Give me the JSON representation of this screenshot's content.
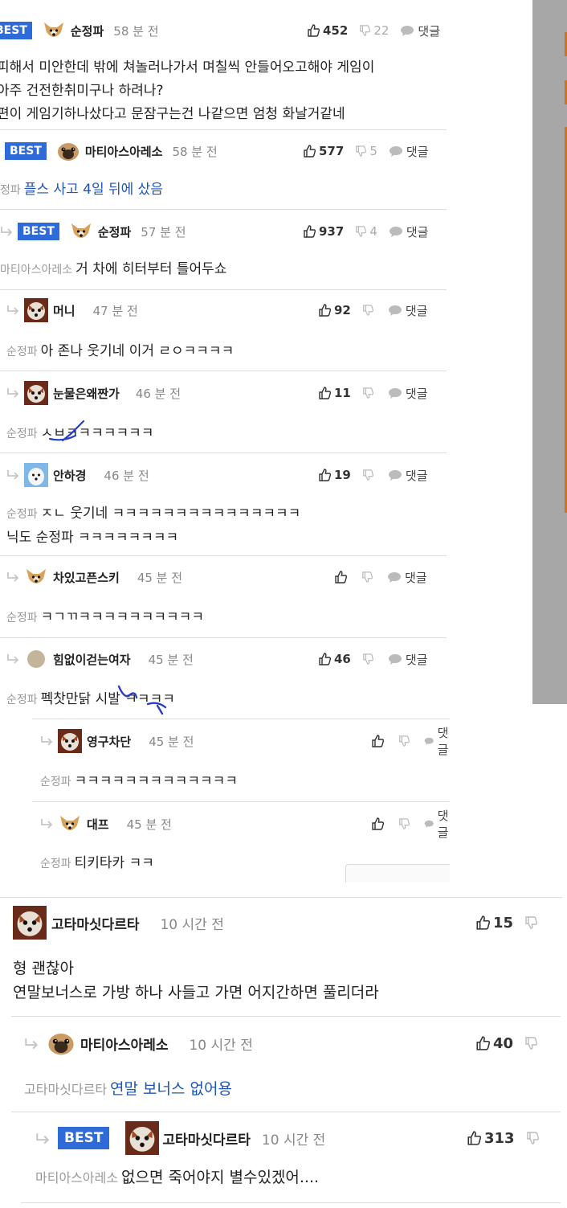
{
  "top_comments": [
    {
      "best": true,
      "name": "순정파",
      "time": "58 분 전",
      "likes": "452",
      "dislikes": "22",
      "reply_label": "댓글",
      "to": "",
      "text": "피해서 미안한데 밖에 쳐놀러나가서 며칠씩 안들어오고해야 게임이\n아주 건전한취미구나 하려나?\n편이 게임기하나샀다고 문잠구는건 나같으면 엄청 화날거같네"
    },
    {
      "best": true,
      "name": "마티아스아레소",
      "time": "58 분 전",
      "likes": "577",
      "dislikes": "5",
      "reply_label": "댓글",
      "to": "정파",
      "text": "플스 사고 4일 뒤에 샀음"
    },
    {
      "best": true,
      "name": "순정파",
      "time": "57 분 전",
      "likes": "937",
      "dislikes": "4",
      "reply_label": "댓글",
      "to": "마티아스아레소",
      "text": "거 차에 히터부터 틀어두쇼"
    },
    {
      "best": false,
      "name": "머니",
      "time": "47 분 전",
      "likes": "92",
      "dislikes": "",
      "reply_label": "댓글",
      "to": "순정파",
      "text": "아 존나 웃기네 이거 ㄹㅇㅋㅋㅋㅋ"
    },
    {
      "best": false,
      "name": "눈물은왜짠가",
      "time": "46 분 전",
      "likes": "11",
      "dislikes": "",
      "reply_label": "댓글",
      "to": "순정파",
      "text": "ㅅㅂㅋㅋㅋㅋㅋㅋㅋ"
    },
    {
      "best": false,
      "name": "안하경",
      "time": "46 분 전",
      "likes": "19",
      "dislikes": "",
      "reply_label": "댓글",
      "to": "순정파",
      "text": "ㅈㄴ 웃기네 ㅋㅋㅋㅋㅋㅋㅋㅋㅋㅋㅋㅋㅋㅋㅋ\n닉도 순정파 ㅋㅋㅋㅋㅋㅋㅋㅋ"
    },
    {
      "best": false,
      "name": "차있고픈스키",
      "time": "45 분 전",
      "likes": "",
      "dislikes": "",
      "reply_label": "댓글",
      "to": "순정파",
      "text": "ㅋㄱㄲㅋㅋㅋㅋㅋㅋㅋㅋㅋㅋ"
    },
    {
      "best": false,
      "name": "힘없이걷는여자",
      "time": "45 분 전",
      "likes": "46",
      "dislikes": "",
      "reply_label": "댓글",
      "to": "순정파",
      "text": "펙찻만닭 시발 ㅋㅋㅋㅋ"
    },
    {
      "best": false,
      "name": "영구차단",
      "time": "45 분 전",
      "likes": "",
      "dislikes": "",
      "reply_label": "댓글",
      "to": "순정파",
      "text": "ㅋㅋㅋㅋㅋㅋㅋㅋㅋㅋㅋㅋㅋ"
    },
    {
      "best": false,
      "name": "대프",
      "time": "45 분 전",
      "likes": "",
      "dislikes": "",
      "reply_label": "댓글",
      "to": "순정파",
      "text": "티키타카 ㅋㅋ"
    }
  ],
  "bottom_comments": [
    {
      "best": false,
      "name": "고타마싯다르타",
      "time": "10 시간 전",
      "likes": "15",
      "to": "",
      "text": "형 괜찮아\n연말보너스로 가방 하나 사들고 가면 어지간하면 풀리더라"
    },
    {
      "best": false,
      "name": "마티아스아레소",
      "time": "10 시간 전",
      "likes": "40",
      "to": "고타마싯다르타",
      "text": "연말 보너스 없어용"
    },
    {
      "best": true,
      "name": "고타마싯다르타",
      "time": "10 시간 전",
      "likes": "313",
      "to": "마티아스아레소",
      "text": "없으면 죽어야지 별수있겠어...."
    }
  ],
  "best_badge": "BEST",
  "colors": {
    "best_badge": "#2e6bd8",
    "mention_link": "#1f54b8",
    "side_panel": "#a7a7a7",
    "side_accent": "#d0731f"
  }
}
